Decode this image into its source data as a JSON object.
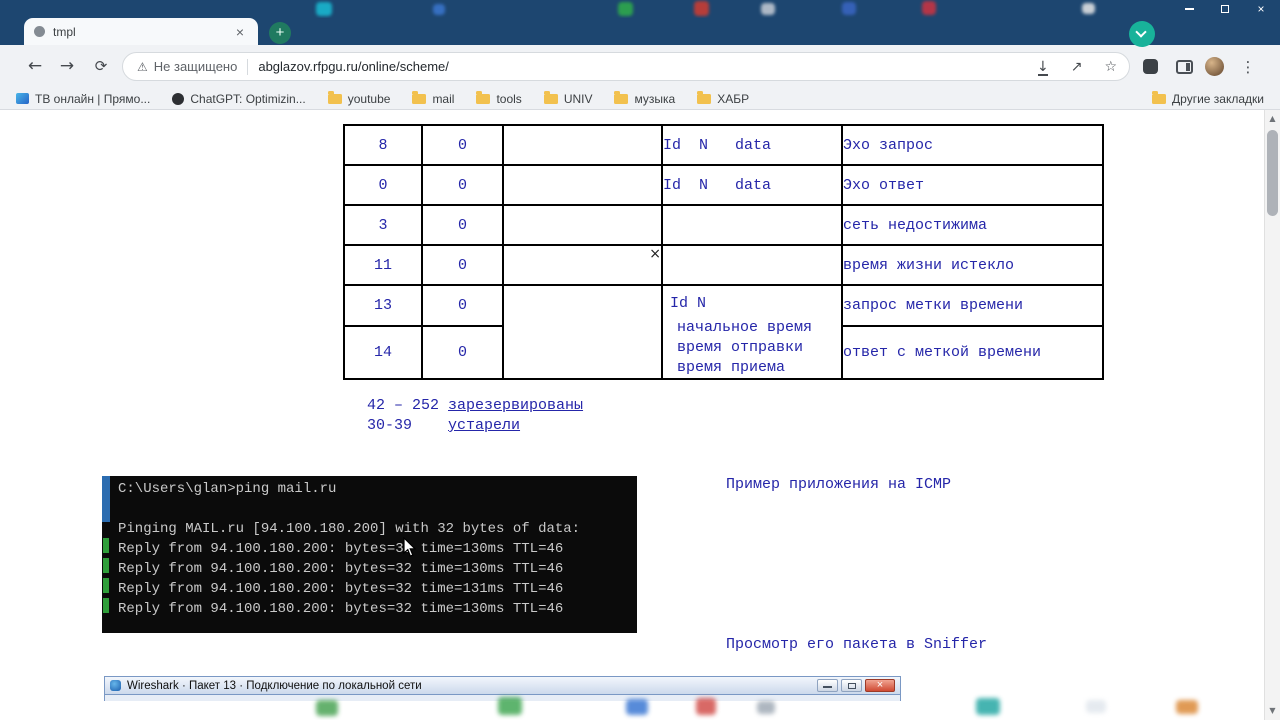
{
  "tab": {
    "title": "tmpl"
  },
  "nav": {
    "security_label": "Не защищено",
    "url": "abglazov.rfpgu.ru/online/scheme/"
  },
  "bookmarks": {
    "items": [
      {
        "label": "ТВ онлайн | Прямо...",
        "icon": "tv-icon"
      },
      {
        "label": "ChatGPT: Optimizin...",
        "icon": "chatgpt-icon"
      },
      {
        "label": "youtube",
        "icon": "folder-icon"
      },
      {
        "label": "mail",
        "icon": "folder-icon"
      },
      {
        "label": "tools",
        "icon": "folder-icon"
      },
      {
        "label": "UNIV",
        "icon": "folder-icon"
      },
      {
        "label": "музыка",
        "icon": "folder-icon"
      },
      {
        "label": "ХАБР",
        "icon": "folder-icon"
      }
    ],
    "other_label": "Другие закладки"
  },
  "icmp_table": {
    "marker": "×",
    "rows": [
      {
        "type": "8",
        "code": "0",
        "fields": "Id  N   data",
        "meaning": "Эхо запрос"
      },
      {
        "type": "0",
        "code": "0",
        "fields": "Id  N   data",
        "meaning": "Эхо ответ"
      },
      {
        "type": "3",
        "code": "0",
        "fields": "",
        "meaning": "сеть недостижима"
      },
      {
        "type": "11",
        "code": "0",
        "fields": "",
        "meaning": "время жизни истекло"
      },
      {
        "type": "13",
        "code": "0",
        "fields": "Id N",
        "meaning": "запрос метки времени"
      },
      {
        "type": "14",
        "code": "0",
        "fields": [
          "начальное время",
          "время отправки",
          "время приема"
        ],
        "meaning": "ответ с меткой времени"
      }
    ],
    "notes": [
      {
        "prefix": "42 – 252 ",
        "underlined": "зарезервированы"
      },
      {
        "prefix": "30-39    ",
        "underlined": "устарели"
      }
    ]
  },
  "terminal": {
    "lines": [
      "C:\\Users\\glan>ping mail.ru",
      "",
      "Pinging MAIL.ru [94.100.180.200] with 32 bytes of data:",
      "Reply from 94.100.180.200: bytes=32 time=130ms TTL=46",
      "Reply from 94.100.180.200: bytes=32 time=130ms TTL=46",
      "Reply from 94.100.180.200: bytes=32 time=131ms TTL=46",
      "Reply from 94.100.180.200: bytes=32 time=130ms TTL=46"
    ]
  },
  "captions": {
    "icmp_example": "Пример приложения на ICMP",
    "sniffer": "Просмотр его пакета в Sniffer"
  },
  "wireshark": {
    "title": "Wireshark · Пакет 13 · Подключение по локальной сети"
  },
  "icons": {
    "back": "←",
    "forward": "→",
    "reload": "⟳",
    "close_x": "×",
    "warning": "⚠",
    "download": "↓",
    "share": "↗",
    "star": "☆",
    "menu": "⋮",
    "plus": "+",
    "scroll_up": "▲",
    "scroll_down": "▼"
  }
}
